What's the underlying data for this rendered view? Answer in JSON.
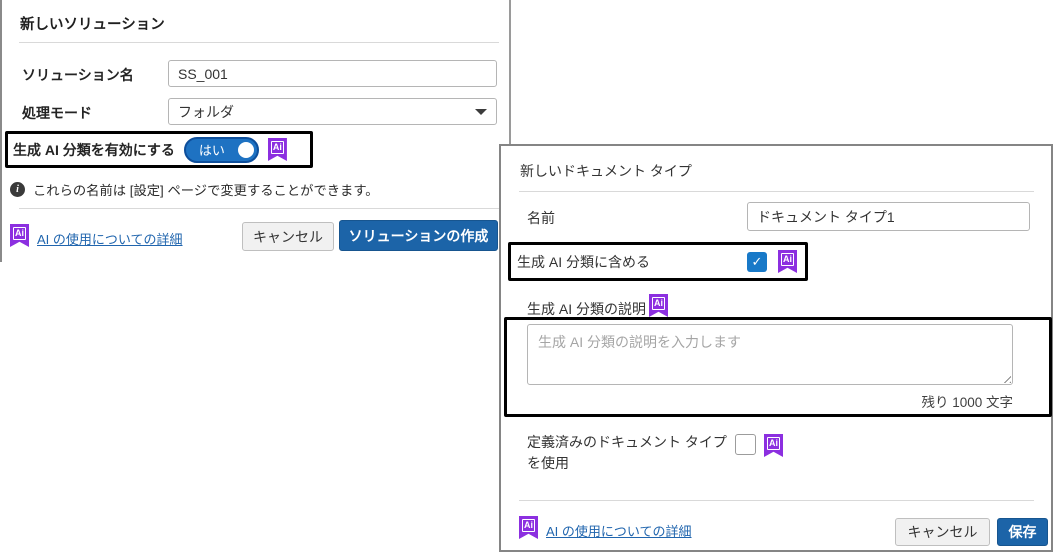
{
  "icons": {
    "ai_label": "Ai",
    "checkmark": "✓",
    "info": "i"
  },
  "colors": {
    "primary_button_blue": "#1c64a8",
    "toggle_blue": "#1e72c2",
    "checkbox_blue": "#1879c8",
    "ai_badge_purple": "#8c2fe0",
    "link_blue": "#2065ae",
    "highlight_border": "#000000"
  },
  "left_dialog": {
    "title": "新しいソリューション",
    "solution_name": {
      "label": "ソリューション名",
      "value": "SS_001"
    },
    "processing_mode": {
      "label": "処理モード",
      "value": "フォルダ"
    },
    "ai_toggle": {
      "label": "生成 AI 分類を有効にする",
      "state": "はい"
    },
    "info_text": "これらの名前は [設定] ページで変更することができます。",
    "ai_link": "AI の使用についての詳細",
    "cancel_label": "キャンセル",
    "create_label": "ソリューションの作成"
  },
  "right_dialog": {
    "title": "新しいドキュメント タイプ",
    "name": {
      "label": "名前",
      "value": "ドキュメント タイプ1"
    },
    "include": {
      "label": "生成 AI 分類に含める"
    },
    "description": {
      "label": "生成 AI 分類の説明",
      "placeholder": "生成 AI 分類の説明を入力します",
      "remaining": "残り 1000 文字"
    },
    "predefined": {
      "label": "定義済みのドキュメント タイプを使用"
    },
    "ai_link": "AI の使用についての詳細",
    "cancel_label": "キャンセル",
    "save_label": "保存"
  }
}
